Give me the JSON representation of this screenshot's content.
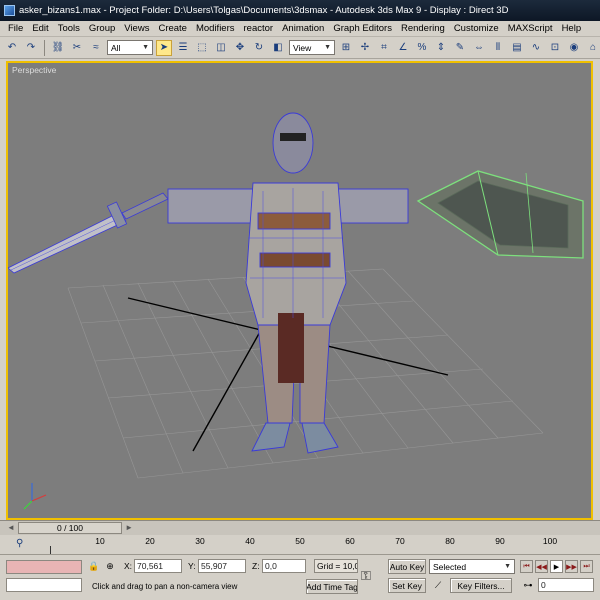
{
  "window": {
    "title": "asker_bizans1.max    - Project Folder: D:\\Users\\Tolgas\\Documents\\3dsmax    - Autodesk 3ds Max 9    - Display : Direct 3D"
  },
  "menu": {
    "items": [
      "File",
      "Edit",
      "Tools",
      "Group",
      "Views",
      "Create",
      "Modifiers",
      "reactor",
      "Animation",
      "Graph Editors",
      "Rendering",
      "Customize",
      "MAXScript",
      "Help"
    ]
  },
  "toolbar": {
    "selection_filter": "All",
    "reference_coord": "View",
    "named_selection": ""
  },
  "viewport": {
    "label": "Perspective",
    "background": "#7d7d7d",
    "active_border": "#f0c000"
  },
  "time": {
    "slider_label": "0 / 100",
    "ticks": [
      "10",
      "20",
      "30",
      "40",
      "50",
      "60",
      "70",
      "80",
      "90",
      "100"
    ]
  },
  "status": {
    "x_label": "X:",
    "x_value": "70,561",
    "y_label": "Y:",
    "y_value": "55,907",
    "z_label": "Z:",
    "z_value": "0,0",
    "grid": "Grid = 10,0",
    "prompt": "Click and drag to pan a non-camera view",
    "add_time_tag": "Add Time Tag",
    "auto_key": "Auto Key",
    "set_key": "Set Key",
    "key_mode_selected": "Selected",
    "key_filters": "Key Filters...",
    "frame": "0"
  },
  "icons": [
    "undo-icon",
    "redo-icon",
    "link-icon",
    "unlink-icon",
    "bind-space-warp-icon",
    "select-icon",
    "select-by-name-icon",
    "rect-region-icon",
    "window-crossing-icon",
    "move-icon",
    "rotate-icon",
    "scale-icon",
    "key-icon",
    "lock-icon",
    "axis-tripod-icon"
  ],
  "colors": {
    "accent_yellow": "#f0c000",
    "wire_blue": "#3a3ad8",
    "shield_wire": "#7de07d"
  }
}
